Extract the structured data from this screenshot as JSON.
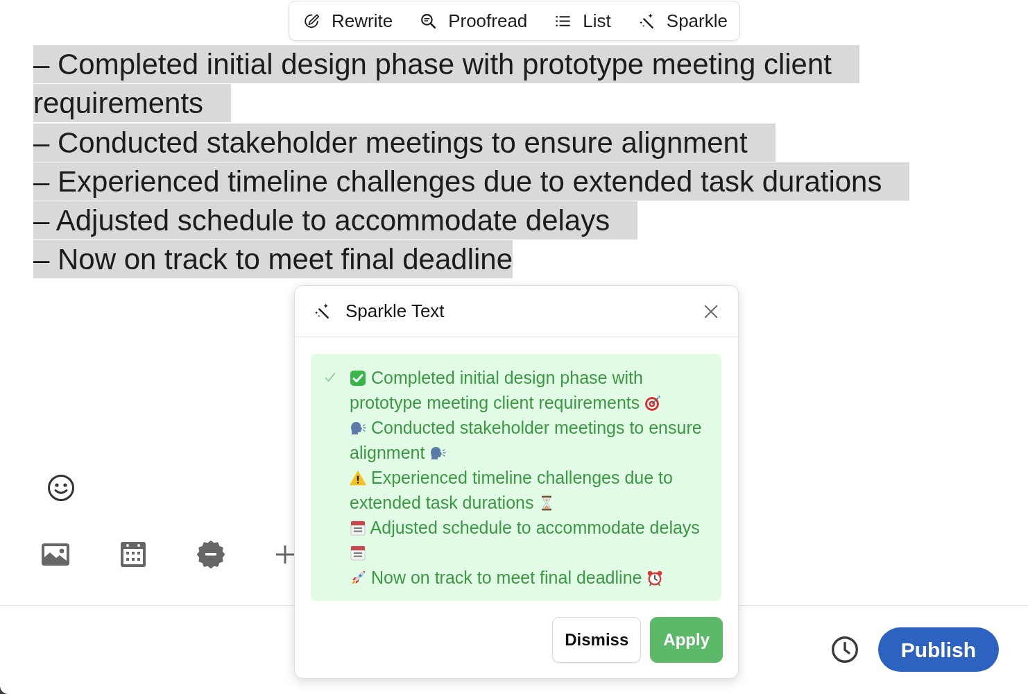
{
  "toolbar": [
    {
      "label": "Rewrite"
    },
    {
      "label": "Proofread"
    },
    {
      "label": "List"
    },
    {
      "label": "Sparkle"
    }
  ],
  "editor": {
    "lines": [
      {
        "text": "– Completed initial design phase with prototype meeting client",
        "selected": true
      },
      {
        "text": "requirements",
        "selected": true
      },
      {
        "text": "– Conducted stakeholder meetings to ensure alignment",
        "selected": true
      },
      {
        "text": "– Experienced timeline challenges due to extended task durations",
        "selected": true
      },
      {
        "text": "– Adjusted schedule to accommodate delays",
        "selected": true
      },
      {
        "text": "– Now on track to meet final deadline",
        "selected": true
      }
    ]
  },
  "sparkle_panel": {
    "title": "Sparkle Text",
    "suggestion": {
      "items": [
        {
          "lines": [
            "Completed initial design phase with",
            "prototype meeting client requirements"
          ]
        },
        {
          "lines": [
            "Conducted stakeholder meetings to ensure",
            "alignment"
          ]
        },
        {
          "lines": [
            "Experienced timeline challenges due to",
            "extended task durations"
          ]
        },
        {
          "lines": [
            "Adjusted schedule to accommodate delays"
          ]
        },
        {
          "lines": [
            "Now on track to meet final deadline"
          ]
        }
      ]
    },
    "buttons": [
      {
        "label": "Dismiss",
        "kind": "secondary"
      },
      {
        "label": "Apply",
        "kind": "primary"
      }
    ]
  },
  "footer": {
    "publish_button": {
      "label": "Publish"
    }
  }
}
